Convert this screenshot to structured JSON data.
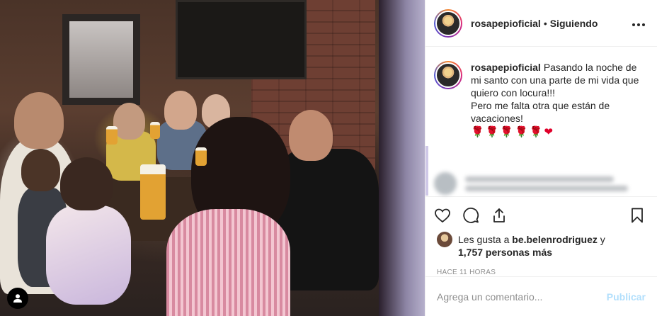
{
  "post": {
    "username": "rosapepioficial",
    "follow_status": "Siguiendo",
    "more_icon": "more-options-icon",
    "caption_lines": "Pasando la noche de mi santo con una parte de mi vida que quiero con locura!!!\nPero me falta otra que están de vacaciones!",
    "caption_emojis": "🌹🌹🌹🌹🌹",
    "caption_heart": "❤",
    "likes_prefix": "Les gusta a",
    "likes_user": "be.belenrodriguez",
    "likes_and": "y",
    "likes_others": "1,757 personas más",
    "timestamp": "HACE 11 HORAS"
  },
  "actions": {
    "like_icon": "heart-icon",
    "comment_icon": "comment-icon",
    "share_icon": "share-icon",
    "save_icon": "bookmark-icon"
  },
  "comment_box": {
    "placeholder": "Agrega un comentario...",
    "publish_label": "Publicar"
  },
  "colors": {
    "link_disabled": "#b2dffc",
    "muted": "#8e8e8e",
    "text": "#262626",
    "border": "#efefef"
  }
}
